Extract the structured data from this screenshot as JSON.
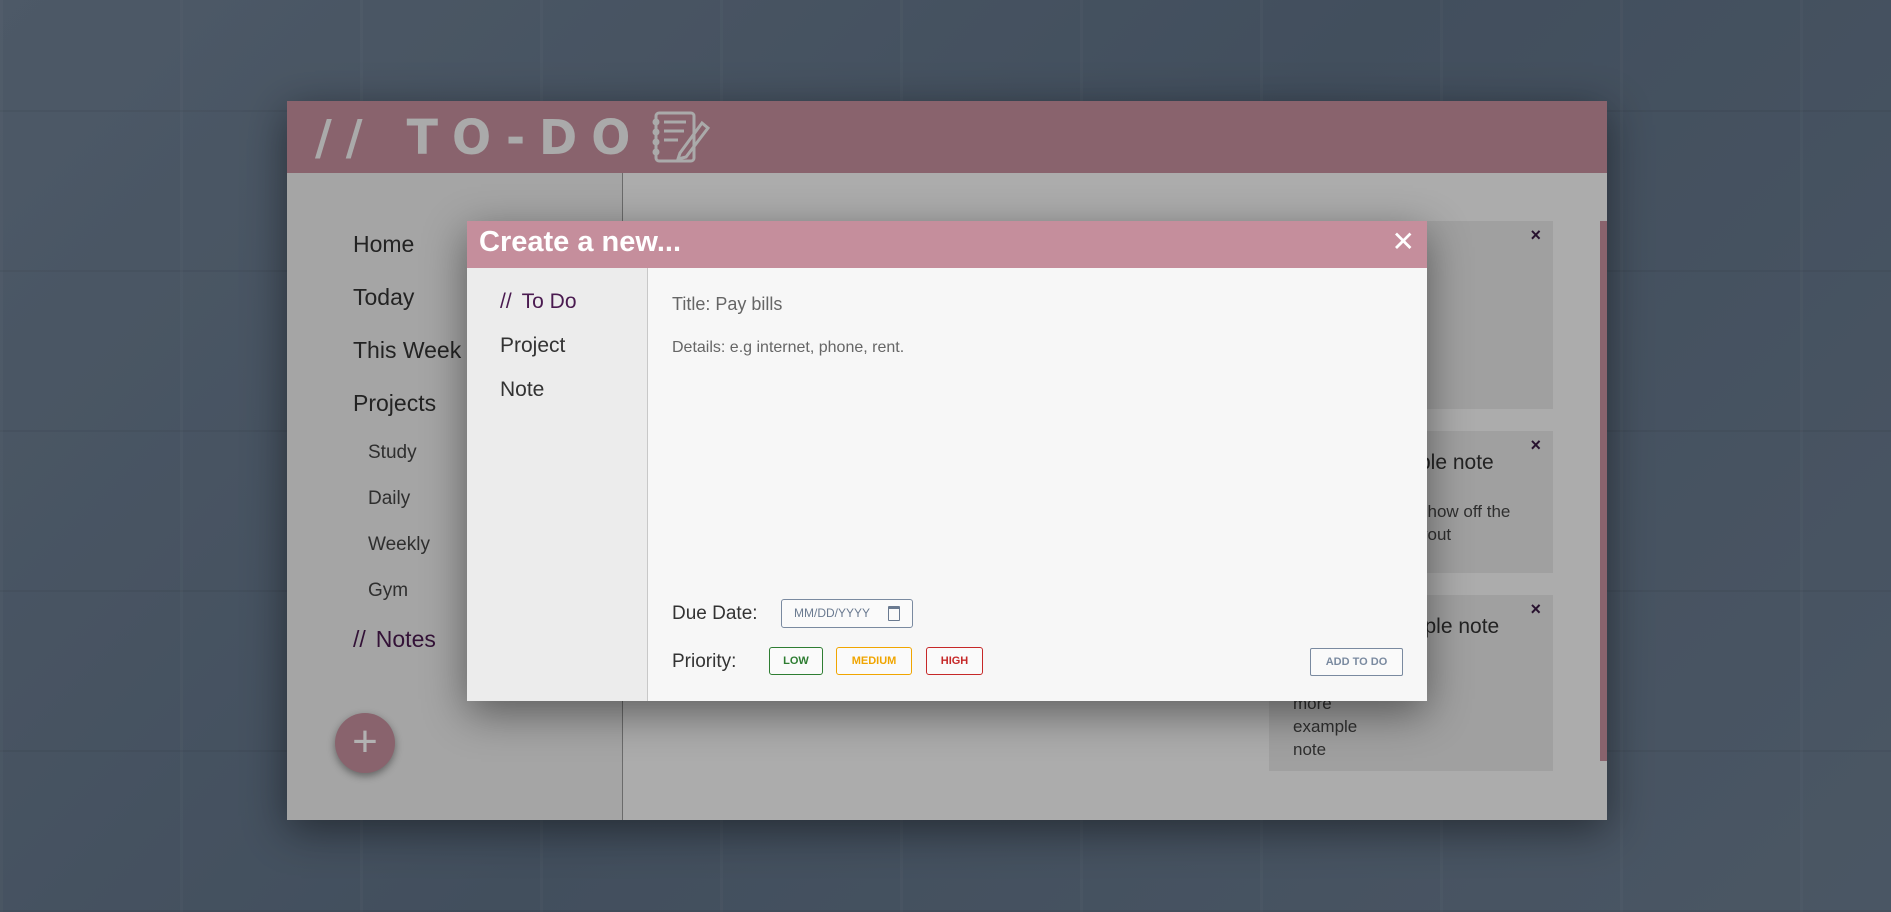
{
  "app": {
    "logo_text": "// TO-DO",
    "logo_icon": "notepad-pencil-icon"
  },
  "sidebar": {
    "items": [
      {
        "label": "Home"
      },
      {
        "label": "Today"
      },
      {
        "label": "This Week"
      },
      {
        "label": "Projects"
      }
    ],
    "projects": [
      {
        "label": "Study"
      },
      {
        "label": "Daily"
      },
      {
        "label": "Weekly"
      },
      {
        "label": "Gym"
      }
    ],
    "active": {
      "slashes": "//",
      "label": "Notes"
    },
    "fab_icon": "+"
  },
  "main": {
    "cards": [
      {
        "close": "×",
        "title": "",
        "body": ""
      },
      {
        "close": "×",
        "title": "ple note",
        "body_line1": "show off the",
        "body_line2": "yout"
      },
      {
        "close": "×",
        "title": "mple note",
        "body_line1": "more",
        "body_line2": "example",
        "body_line3": "note"
      }
    ]
  },
  "modal": {
    "title": "Create a new...",
    "close": "✕",
    "tabs": [
      {
        "slashes": "//",
        "label": "To Do"
      },
      {
        "label": "Project"
      },
      {
        "label": "Note"
      }
    ],
    "title_placeholder": "Title: Pay bills",
    "details_placeholder": "Details: e.g internet, phone, rent.",
    "due_date_label": "Due Date:",
    "date_placeholder": "MM/DD/YYYY",
    "priority_label": "Priority:",
    "priorities": [
      {
        "label": "LOW",
        "color": "#2e7d32"
      },
      {
        "label": "MEDIUM",
        "color": "#f0a500"
      },
      {
        "label": "HIGH",
        "color": "#c62828"
      }
    ],
    "add_button": "ADD TO DO"
  },
  "colors": {
    "accent": "#c58e9c",
    "active_text": "#4a1a50"
  }
}
